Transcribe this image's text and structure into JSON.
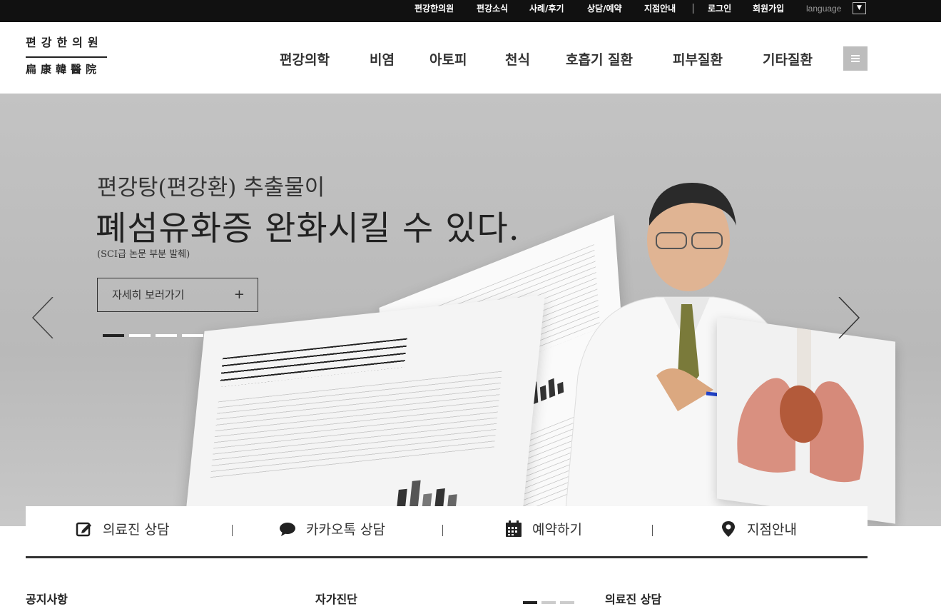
{
  "topbar": {
    "links": [
      "편강한의원",
      "편강소식",
      "사례/후기",
      "상담/예약",
      "지점안내"
    ],
    "login": "로그인",
    "join": "회원가입",
    "language": "language",
    "language_arrow": "▼"
  },
  "logo": {
    "korean": "편강한의원",
    "hanja": "扁康韓醫院"
  },
  "gnb": [
    "편강의학",
    "비염",
    "아토피",
    "천식",
    "호흡기 질환",
    "피부질환",
    "기타질환"
  ],
  "hero": {
    "subtitle": "편강탕(편강환) 추출물이",
    "title": "폐섬유화증 완화시킬 수 있다.",
    "note": "(SCI급 논문 부분 발췌)",
    "button_label": "자세히 보러가기",
    "button_plus": "+",
    "slide_count": 4,
    "active_slide": 1
  },
  "quick_menu": [
    "의료진 상담",
    "카카오톡 상담",
    "예약하기",
    "지점안내"
  ],
  "sections": {
    "notice": "공지사항",
    "self_check": "자가진단",
    "consult": "의료진 상담"
  },
  "colors": {
    "topbar": "#111111",
    "hero_bg": "#bdbdbd",
    "menu_btn": "#bdbdbd"
  }
}
